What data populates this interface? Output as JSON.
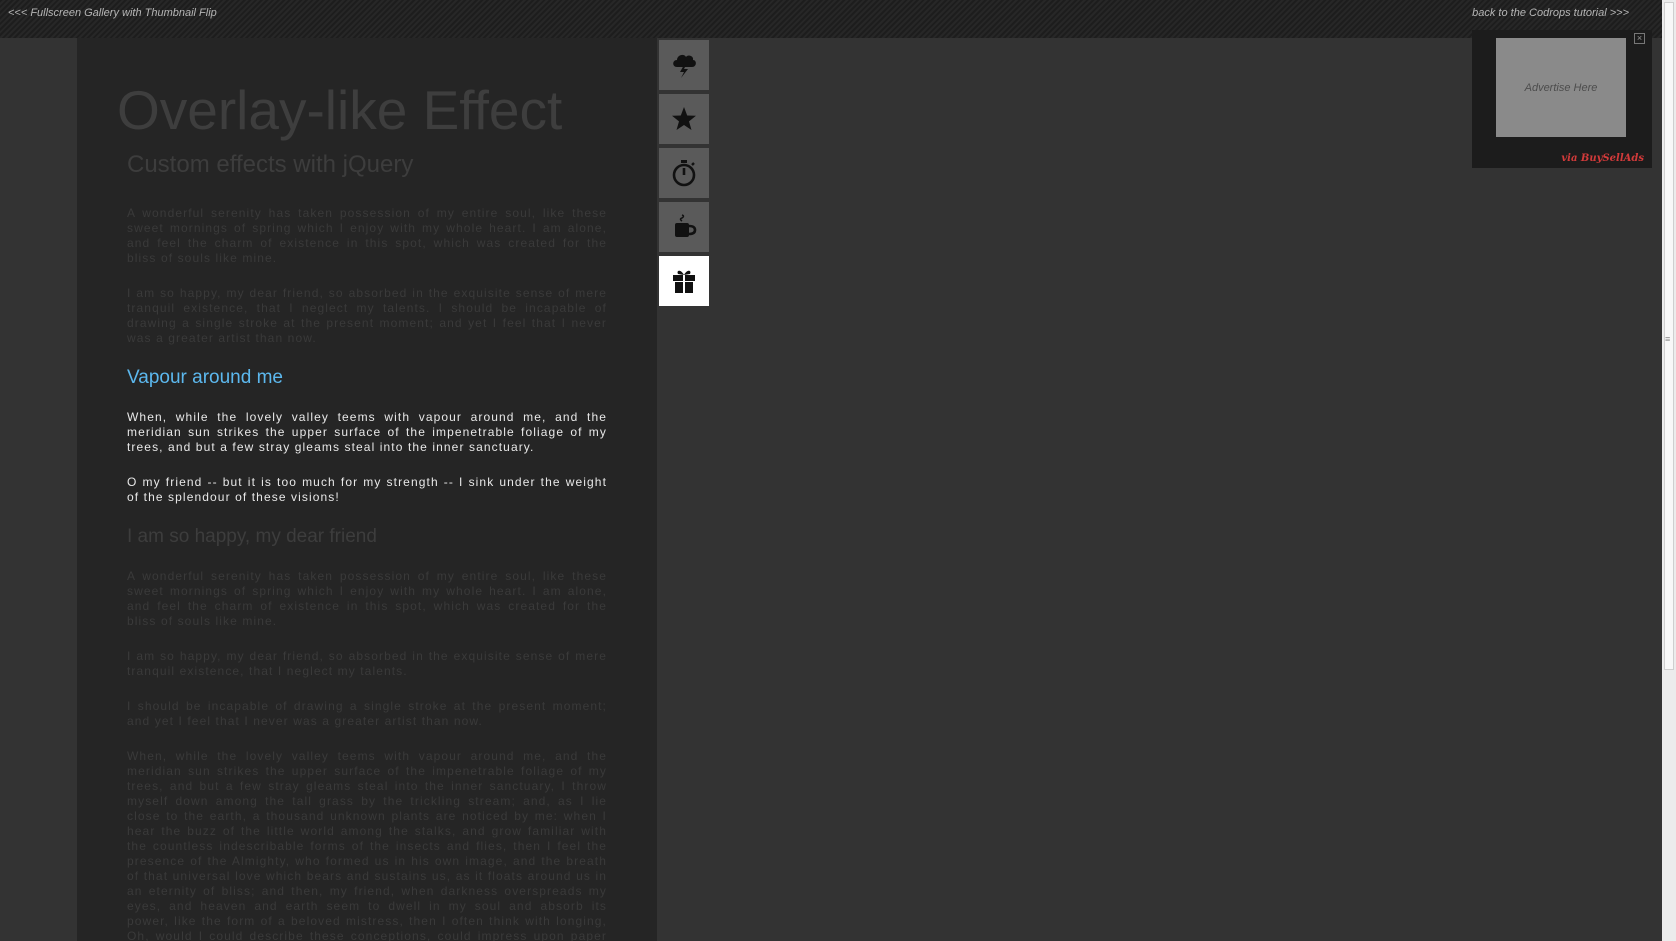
{
  "topbar": {
    "prev_link": "<<< Fullscreen Gallery with Thumbnail Flip",
    "back_link": "back to the Codrops tutorial >>>"
  },
  "page": {
    "title": "Overlay-like Effect"
  },
  "article": {
    "subtitle": "Custom effects with jQuery",
    "intro_paragraphs": [
      "A wonderful serenity has taken possession of my entire soul, like these sweet mornings of spring which I enjoy with my whole heart. I am alone, and feel the charm of existence in this spot, which was created for the bliss of souls like mine.",
      "I am so happy, my dear friend, so absorbed in the exquisite sense of mere tranquil existence, that I neglect my talents. I should be incapable of drawing a single stroke at the present moment; and yet I feel that I never was a greater artist than now."
    ],
    "active_section": {
      "heading": "Vapour around me",
      "paragraphs": [
        "When, while the lovely valley teems with vapour around me, and the meridian sun strikes the upper surface of the impenetrable foliage of my trees, and but a few stray gleams steal into the inner sanctuary.",
        "O my friend -- but it is too much for my strength -- I sink under the weight of the splendour of these visions!"
      ]
    },
    "second_section": {
      "heading": "I am so happy, my dear friend",
      "paragraphs": [
        "A wonderful serenity has taken possession of my entire soul, like these sweet mornings of spring which I enjoy with my whole heart. I am alone, and feel the charm of existence in this spot, which was created for the bliss of souls like mine.",
        "I am so happy, my dear friend, so absorbed in the exquisite sense of mere tranquil existence, that I neglect my talents.",
        "I should be incapable of drawing a single stroke at the present moment; and yet I feel that I never was a greater artist than now.",
        "When, while the lovely valley teems with vapour around me, and the meridian sun strikes the upper surface of the impenetrable foliage of my trees, and but a few stray gleams steal into the inner sanctuary, I throw myself down among the tall grass by the trickling stream; and, as I lie close to the earth, a thousand unknown plants are noticed by me: when I hear the buzz of the little world among the stalks, and grow familiar with the countless indescribable forms of the insects and flies, then I feel the presence of the Almighty, who formed us in his own image, and the breath of that universal love which bears and sustains us, as it floats around us in an eternity of bliss; and then, my friend, when darkness overspreads my eyes, and heaven and earth seem to dwell in my soul and absorb its power, like the form of a beloved mistress, then I often think with longing, Oh, would I could describe these conceptions, could impress upon paper all that is living so full and warm within me."
      ]
    }
  },
  "iconbar": {
    "icons": [
      "storm-cloud-icon",
      "star-icon",
      "stopwatch-icon",
      "coffee-cup-icon",
      "gift-icon"
    ],
    "selected_index": 4
  },
  "ad": {
    "label": "Advertise Here",
    "via": "via BuySellAds",
    "close": "×"
  },
  "colors": {
    "background": "#333333",
    "panel": "#252525",
    "accent_heading": "#5cb8ee",
    "icon_button": "#5a5a5a",
    "icon_button_selected": "#ffffff"
  }
}
